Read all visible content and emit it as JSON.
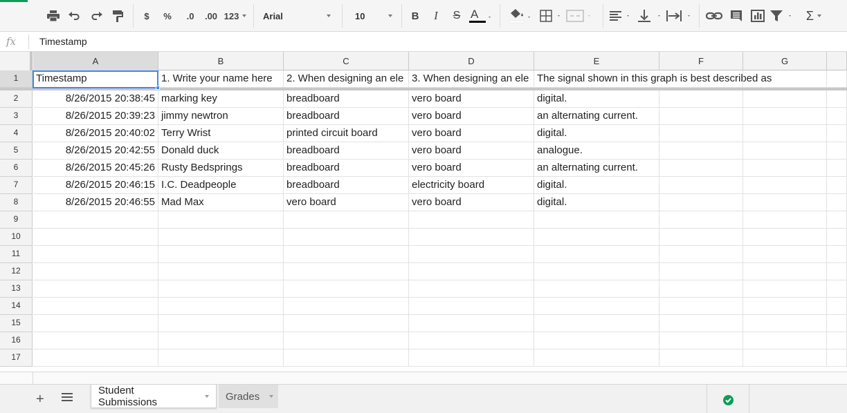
{
  "toolbar": {
    "currency_label": "$",
    "percent_label": "%",
    "decrease_decimal_label": ".0",
    "increase_decimal_label": ".00",
    "more_formats_label": "123",
    "font_family": "Arial",
    "font_size": "10"
  },
  "formula_bar": {
    "fx_label": "fx",
    "value": "Timestamp"
  },
  "columns": [
    "A",
    "B",
    "C",
    "D",
    "E",
    "F",
    "G"
  ],
  "rows": [
    [
      "Timestamp",
      "1. Write your name here",
      "2. When designing an ele",
      "3. When designing an ele",
      "The signal shown in this graph is best described as",
      "",
      ""
    ],
    [
      "8/26/2015 20:38:45",
      "marking key",
      "breadboard",
      "vero board",
      "digital.",
      "",
      ""
    ],
    [
      "8/26/2015 20:39:23",
      "jimmy newtron",
      "breadboard",
      "vero board",
      "an alternating current.",
      "",
      ""
    ],
    [
      "8/26/2015 20:40:02",
      "Terry Wrist",
      "printed circuit board",
      "vero board",
      "digital.",
      "",
      ""
    ],
    [
      "8/26/2015 20:42:55",
      "Donald duck",
      "breadboard",
      "vero board",
      "analogue.",
      "",
      ""
    ],
    [
      "8/26/2015 20:45:26",
      "Rusty Bedsprings",
      "breadboard",
      "vero board",
      "an alternating current.",
      "",
      ""
    ],
    [
      "8/26/2015 20:46:15",
      "I.C. Deadpeople",
      "breadboard",
      "electricity board",
      "digital.",
      "",
      ""
    ],
    [
      "8/26/2015 20:46:55",
      "Mad Max",
      "vero board",
      "vero board",
      "digital.",
      "",
      ""
    ],
    [
      "",
      "",
      "",
      "",
      "",
      "",
      ""
    ],
    [
      "",
      "",
      "",
      "",
      "",
      "",
      ""
    ],
    [
      "",
      "",
      "",
      "",
      "",
      "",
      ""
    ],
    [
      "",
      "",
      "",
      "",
      "",
      "",
      ""
    ],
    [
      "",
      "",
      "",
      "",
      "",
      "",
      ""
    ],
    [
      "",
      "",
      "",
      "",
      "",
      "",
      ""
    ],
    [
      "",
      "",
      "",
      "",
      "",
      "",
      ""
    ],
    [
      "",
      "",
      "",
      "",
      "",
      "",
      ""
    ],
    [
      "",
      "",
      "",
      "",
      "",
      "",
      ""
    ]
  ],
  "row_numbers": [
    "1",
    "2",
    "3",
    "4",
    "5",
    "6",
    "7",
    "8",
    "9",
    "10",
    "11",
    "12",
    "13",
    "14",
    "15",
    "16",
    "17"
  ],
  "sheets": [
    {
      "label": "Student Submissions",
      "active": true
    },
    {
      "label": "Grades",
      "active": false
    }
  ],
  "colors": {
    "accent_green": "#0f9d58",
    "selection_blue": "#4285f4"
  }
}
